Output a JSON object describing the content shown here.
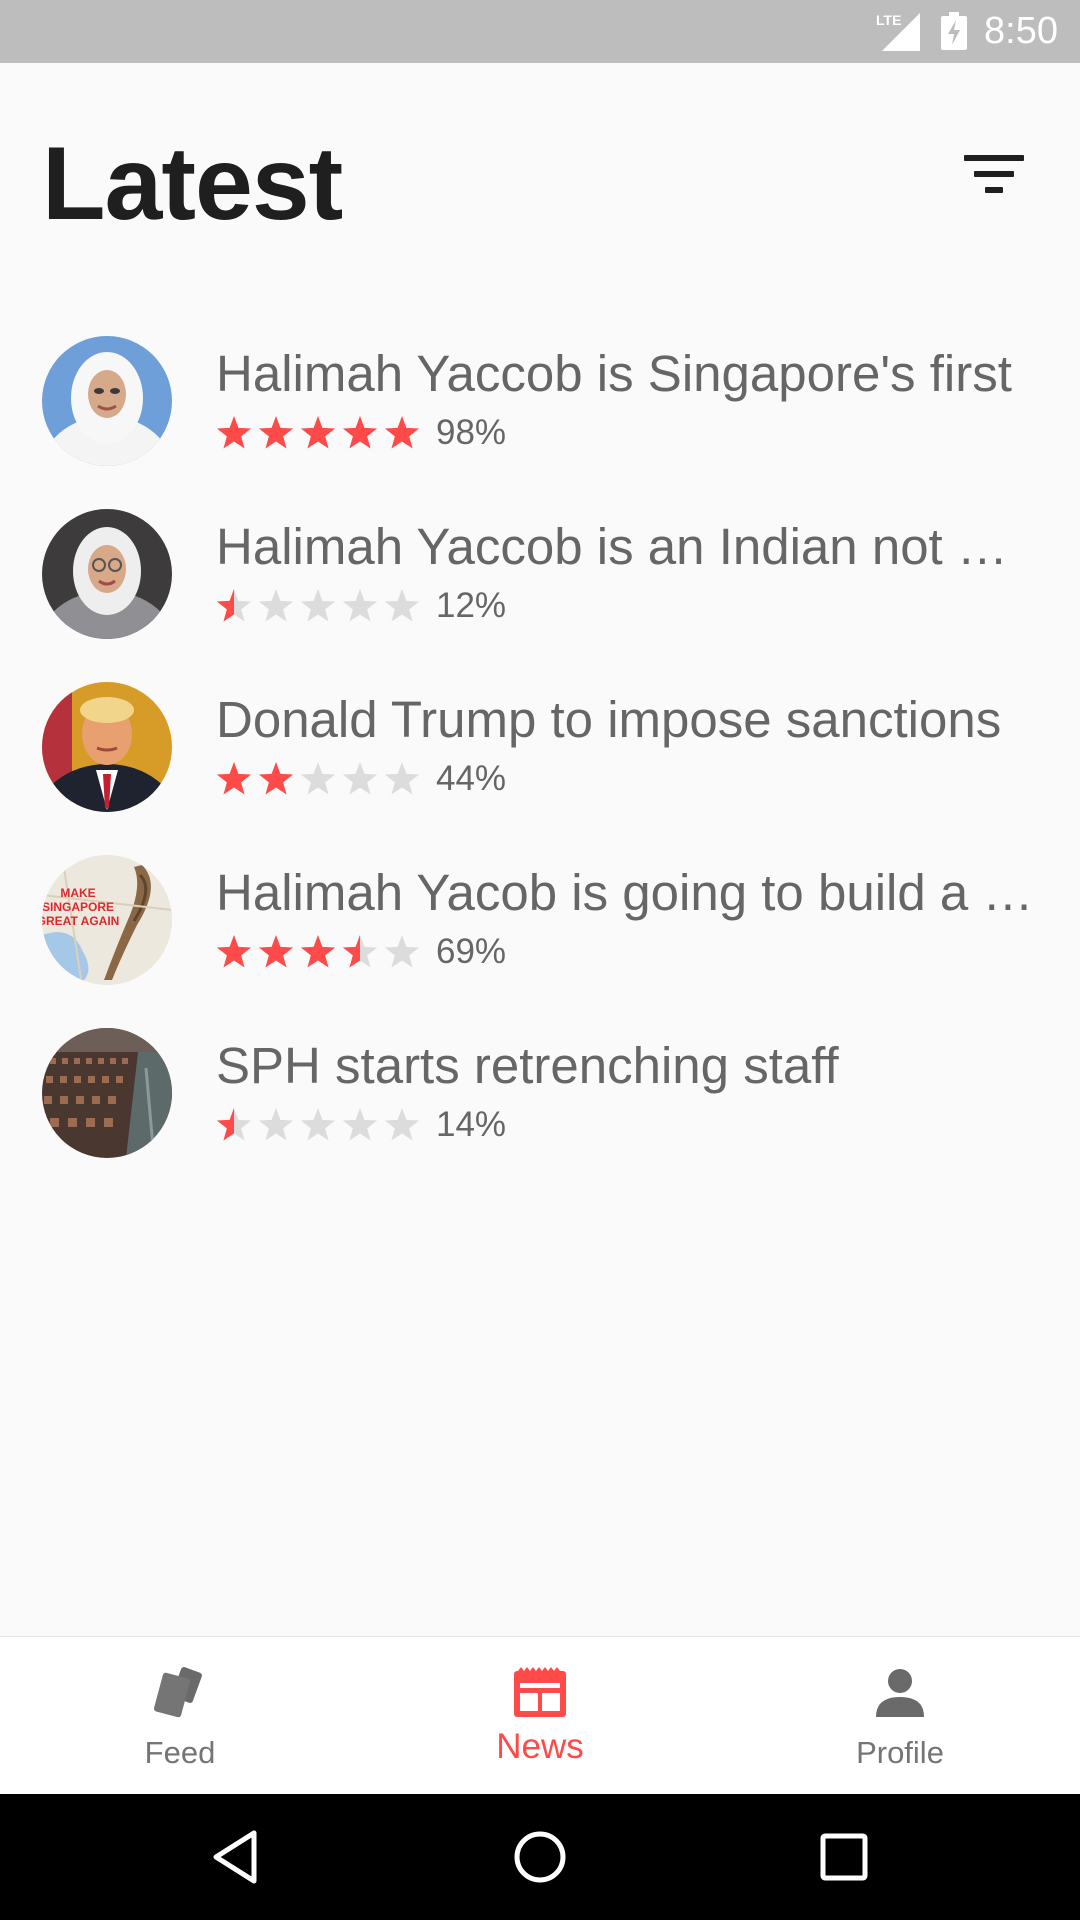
{
  "status_bar": {
    "network": "LTE",
    "time": "8:50"
  },
  "header": {
    "title": "Latest",
    "filter_icon": "filter-list-icon"
  },
  "news": [
    {
      "title": "Halimah Yaccob is Singapore's first",
      "stars": 5,
      "rating_label": "98%",
      "thumb": "woman-in-white-hijab"
    },
    {
      "title": "Halimah Yaccob is an Indian not Malay",
      "stars": 0.5,
      "rating_label": "12%",
      "thumb": "woman-in-hijab-with-glasses"
    },
    {
      "title": "Donald Trump to impose sanctions",
      "stars": 2,
      "rating_label": "44%",
      "thumb": "man-in-suit"
    },
    {
      "title": "Halimah Yacob is going to build a wall",
      "stars": 3.5,
      "rating_label": "69%",
      "thumb": "map-with-wall-poster",
      "thumb_text": [
        "MAKE",
        "SINGAPORE",
        "GREAT AGAIN"
      ]
    },
    {
      "title": "SPH starts retrenching staff",
      "stars": 0.5,
      "rating_label": "14%",
      "thumb": "crowded-auditorium"
    }
  ],
  "colors": {
    "accent": "#ff4a4a",
    "star_empty": "#dcdcdc",
    "text_secondary": "#666666",
    "nav_inactive": "#757575"
  },
  "bottom_nav": {
    "items": [
      {
        "label": "Feed",
        "icon": "cards-icon",
        "active": false
      },
      {
        "label": "News",
        "icon": "newspaper-icon",
        "active": true
      },
      {
        "label": "Profile",
        "icon": "person-icon",
        "active": false
      }
    ]
  },
  "system_nav": {
    "back": "back-triangle-icon",
    "home": "home-circle-icon",
    "recents": "recents-square-icon"
  }
}
